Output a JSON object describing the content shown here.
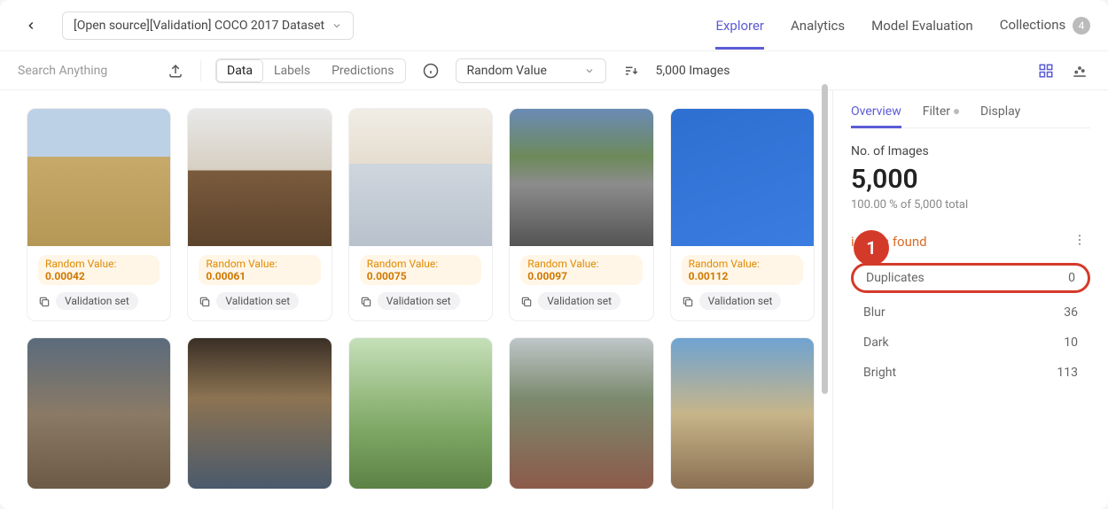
{
  "header": {
    "dataset_name": "[Open source][Validation] COCO 2017 Dataset",
    "tabs": [
      "Explorer",
      "Analytics",
      "Model Evaluation",
      "Collections"
    ],
    "collections_badge": "4"
  },
  "toolbar": {
    "search_placeholder": "Search Anything",
    "segments": [
      "Data",
      "Labels",
      "Predictions"
    ],
    "sort_value": "Random Value",
    "image_count": "5,000 Images"
  },
  "grid": {
    "items": [
      {
        "rv_label": "Random Value: ",
        "rv_value": "0.00042",
        "set": "Validation set",
        "bg": "linear-gradient(180deg,#bcd0e6 0%,#bcd0e6 35%,#c7a96b 35%,#b59756 100%)"
      },
      {
        "rv_label": "Random Value: ",
        "rv_value": "0.00061",
        "set": "Validation set",
        "bg": "linear-gradient(180deg,#e8e8e8 0%,#d6cfc2 45%,#7a5b3d 45%,#5c432c 100%)"
      },
      {
        "rv_label": "Random Value: ",
        "rv_value": "0.00075",
        "set": "Validation set",
        "bg": "linear-gradient(180deg,#f0ede6 0%,#e6ddcf 40%,#cfd6de 40%,#b8c1cc 100%)"
      },
      {
        "rv_label": "Random Value: ",
        "rv_value": "0.00097",
        "set": "Validation set",
        "bg": "linear-gradient(180deg,#6a8bb5 0%,#6d8a5a 35%,#8c8c8c 55%,#545454 100%)"
      },
      {
        "rv_label": "Random Value: ",
        "rv_value": "0.00112",
        "set": "Validation set",
        "bg": "linear-gradient(160deg,#2d6fd1 0%,#3a7ce0 100%)"
      }
    ],
    "row2_bgs": [
      "linear-gradient(180deg,#5b6b7c 0%,#8a7a66 50%,#6d5a46 100%)",
      "linear-gradient(180deg,#3a2f26 0%,#8c7352 40%,#4a5a6c 100%)",
      "linear-gradient(180deg,#c5e0b8 0%,#7fa865 60%,#5c8245 100%)",
      "linear-gradient(180deg,#bfc6c9 0%,#7c8a6e 40%,#8c5a4a 100%)",
      "linear-gradient(180deg,#6fa3d1 0%,#c7b58a 50%,#8a6f52 100%)"
    ]
  },
  "side": {
    "tabs": [
      "Overview",
      "Filter",
      "Display"
    ],
    "stat_label": "No. of Images",
    "stat_value": "5,000",
    "stat_sub": "100.00 % of 5,000 total",
    "issues_found": "issues found",
    "issues": [
      {
        "name": "Duplicates",
        "count": "0"
      },
      {
        "name": "Blur",
        "count": "36"
      },
      {
        "name": "Dark",
        "count": "10"
      },
      {
        "name": "Bright",
        "count": "113"
      }
    ]
  },
  "annotation": "1"
}
